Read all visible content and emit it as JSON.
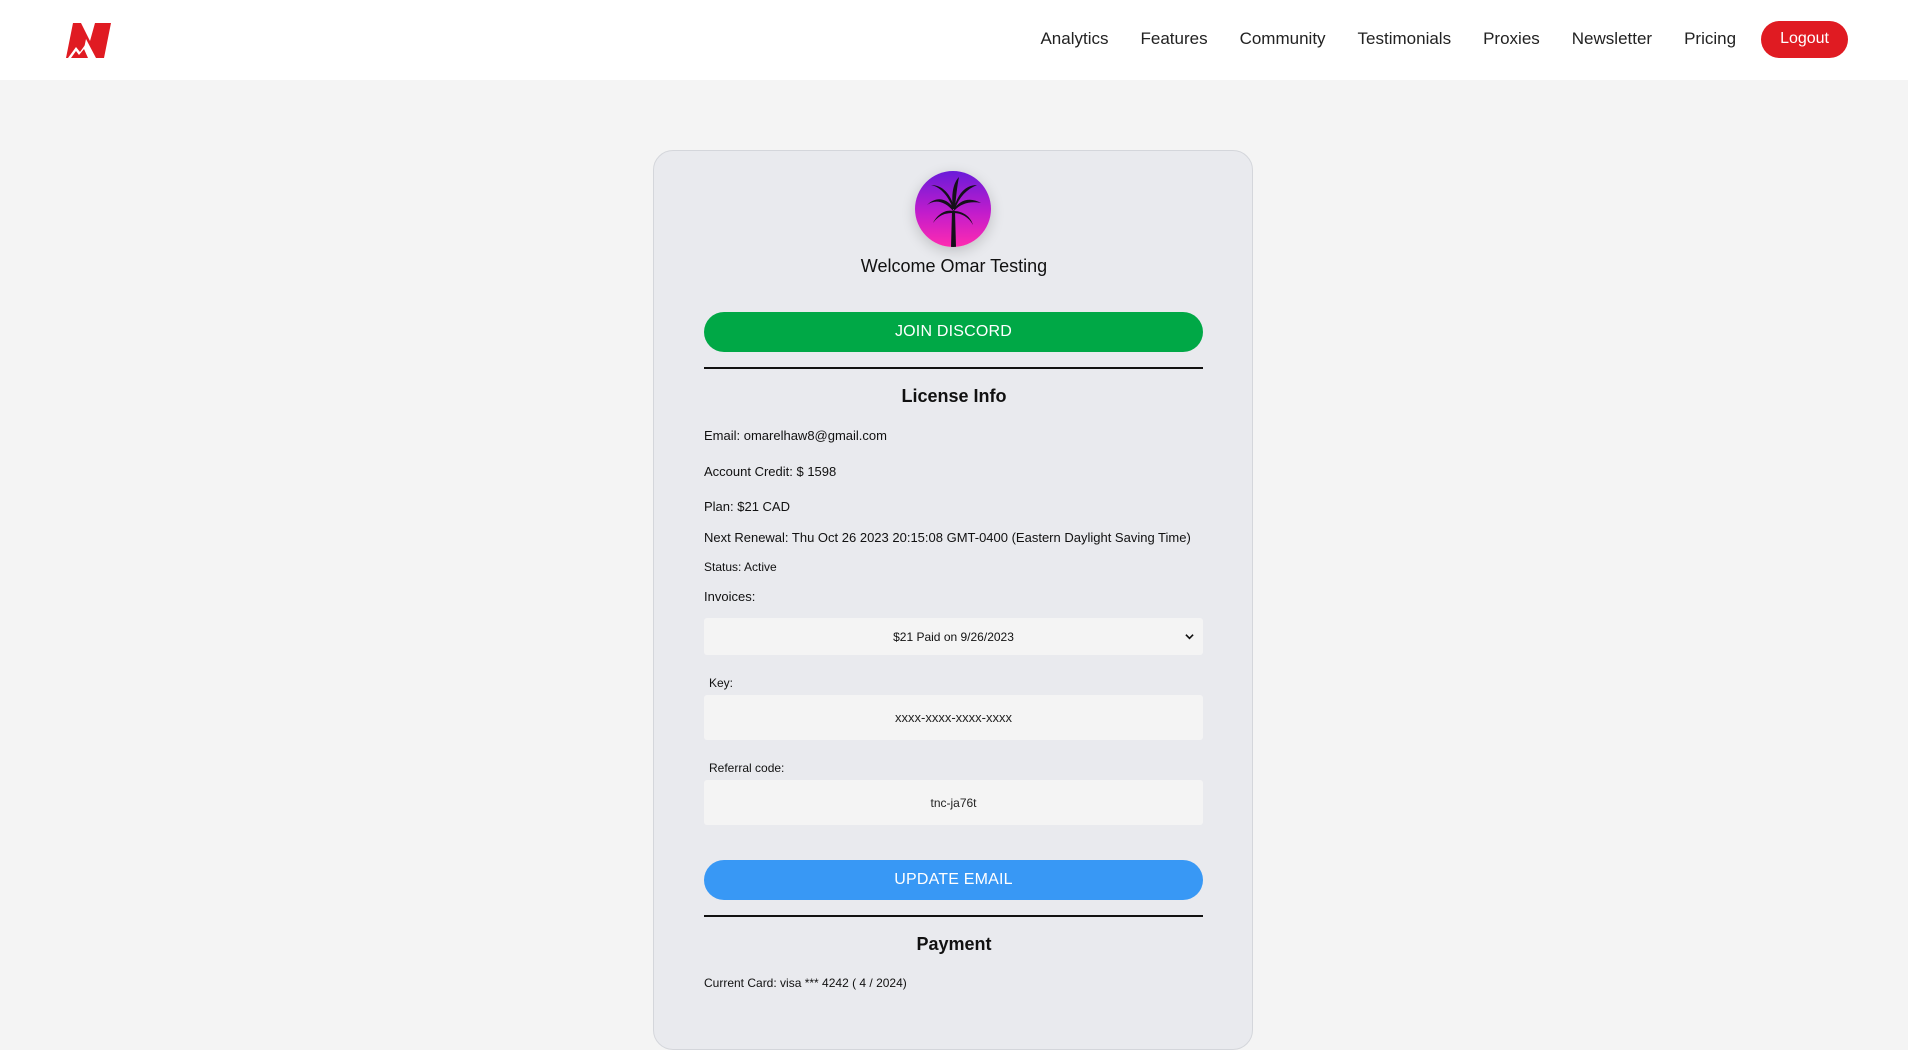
{
  "header": {
    "nav": [
      "Analytics",
      "Features",
      "Community",
      "Testimonials",
      "Proxies",
      "Newsletter",
      "Pricing"
    ],
    "logout_label": "Logout"
  },
  "profile": {
    "welcome": "Welcome Omar Testing",
    "discord_label": "JOIN DISCORD"
  },
  "license": {
    "title": "License Info",
    "email": "Email: omarelhaw8@gmail.com",
    "credit": "Account Credit: $ 1598",
    "plan": "Plan: $21 CAD",
    "renewal": "Next Renewal: Thu Oct 26 2023 20:15:08 GMT-0400 (Eastern Daylight Saving Time)",
    "status": "Status: Active",
    "invoices_label": "Invoices:",
    "invoice_selected": "$21 Paid on 9/26/2023",
    "key_label": "Key:",
    "key_value": "xxxx-xxxx-xxxx-xxxx",
    "referral_label": "Referral code:",
    "referral_value": "tnc-ja76t",
    "update_label": "UPDATE EMAIL"
  },
  "payment": {
    "title": "Payment",
    "current_card": "Current Card: visa *** 4242 ( 4 / 2024)"
  },
  "colors": {
    "brand_red": "#e01b22",
    "discord_green": "#00a846",
    "update_blue": "#3898f5",
    "card_bg": "#e9eaee",
    "page_bg": "#f4f4f4"
  },
  "icons": {
    "logo": "brand-logo-icon",
    "avatar": "palm-tree-avatar",
    "dropdown": "chevron-down-icon"
  }
}
